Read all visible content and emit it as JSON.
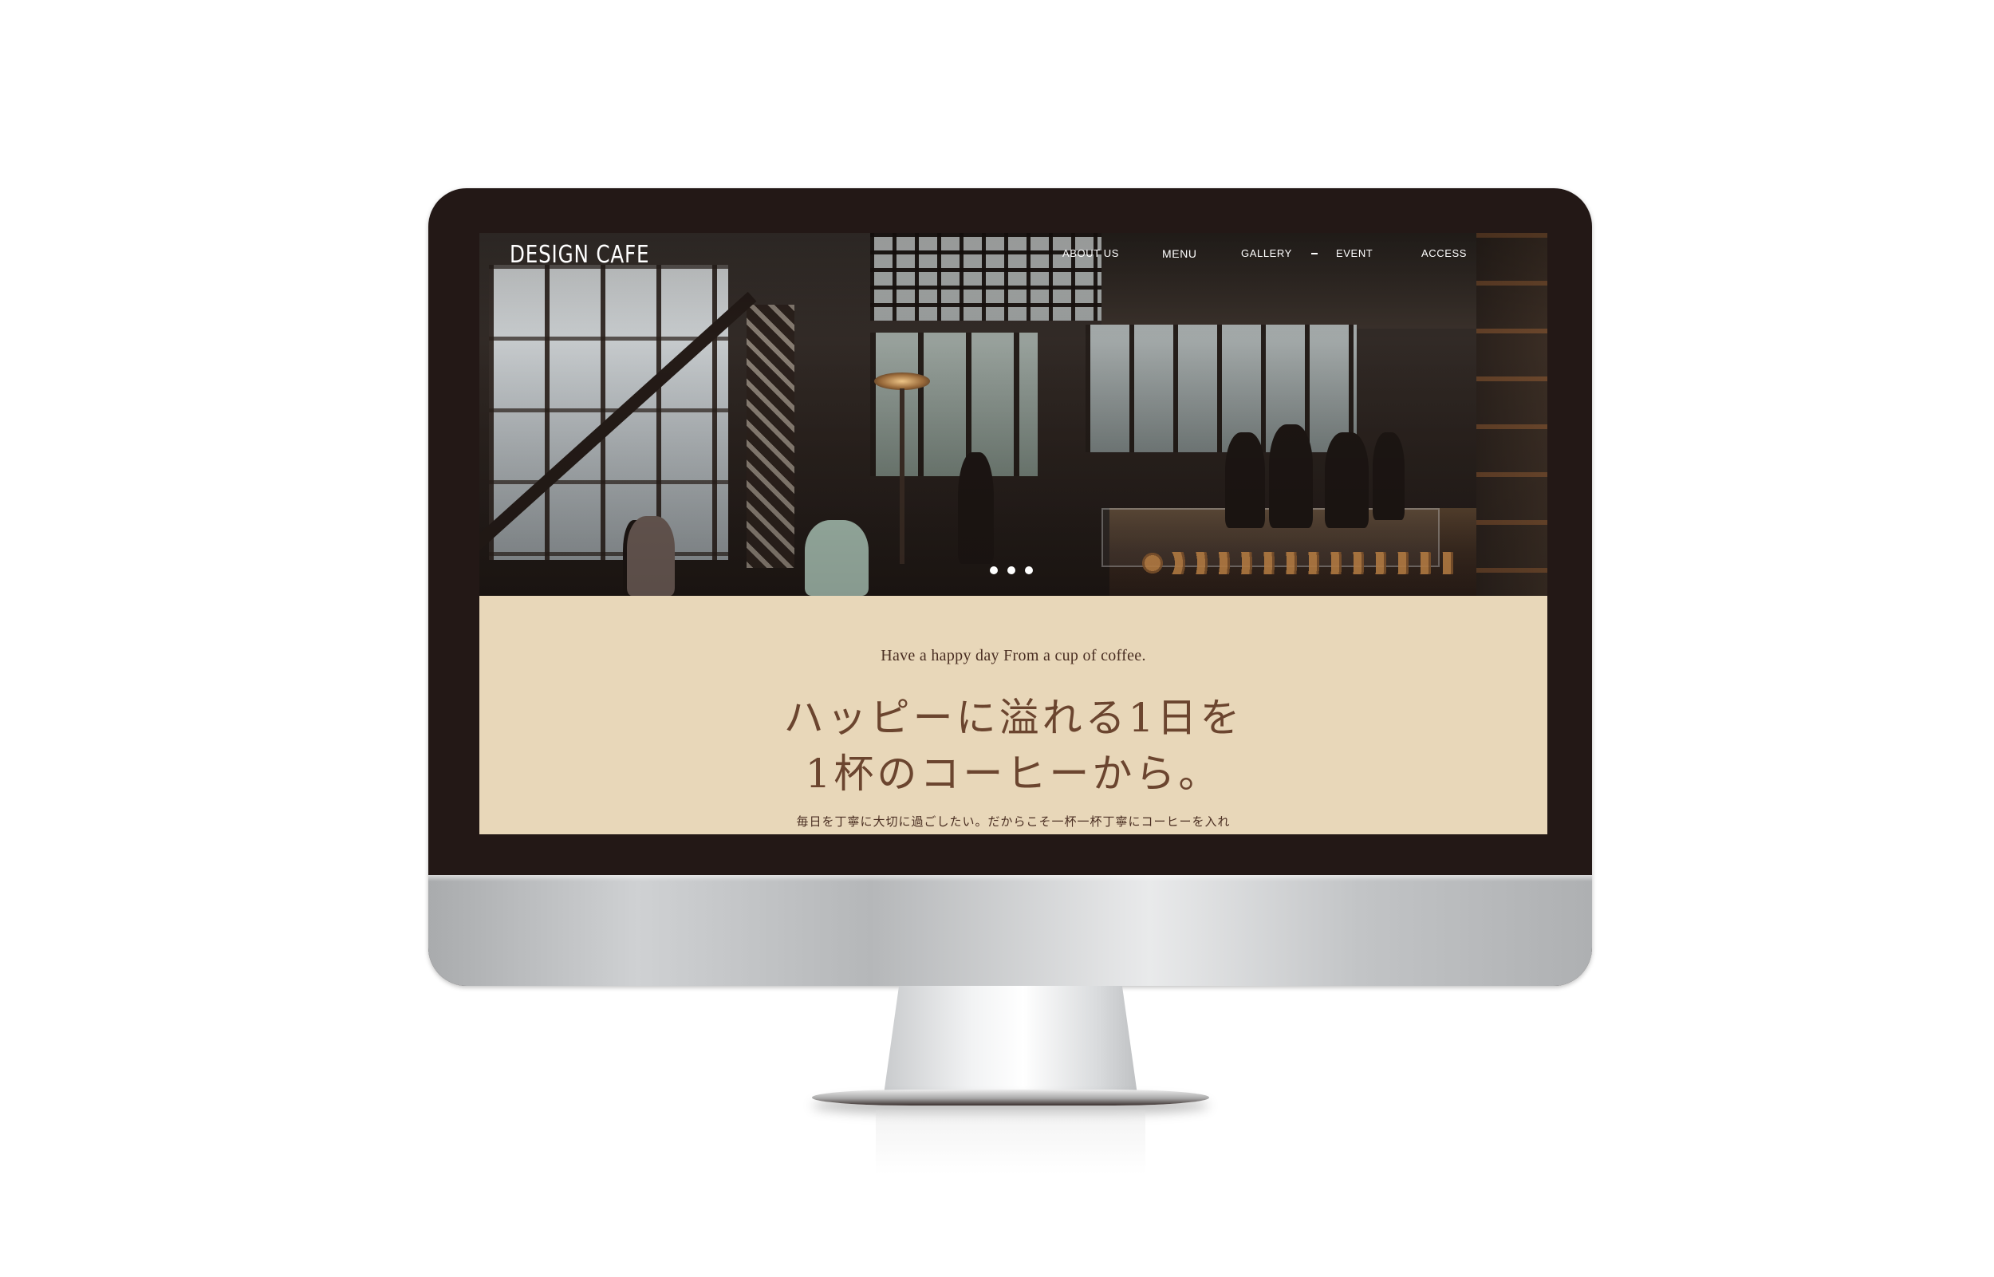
{
  "site": {
    "logo": "DESIGN CAFE"
  },
  "nav": {
    "items": [
      "ABOUT US",
      "MENU",
      "GALLERY",
      "EVENT",
      "ACCESS"
    ]
  },
  "slider": {
    "dot_count": 3
  },
  "content": {
    "tagline": "Have a happy day From a cup of coffee.",
    "headline_line1": "ハッピーに溢れる1日を",
    "headline_line2": "1杯のコーヒーから。",
    "body": "毎日を丁寧に大切に過ごしたい。だからこそ一杯一杯丁寧にコーヒーを入れ"
  },
  "colors": {
    "monitor_bezel": "#231816",
    "content_background": "#e8d7b9",
    "headline_text": "#6b452f",
    "body_text": "#4a2e22",
    "nav_text": "#ffffff"
  },
  "icons": {
    "slider_dots": "dot-icon"
  }
}
